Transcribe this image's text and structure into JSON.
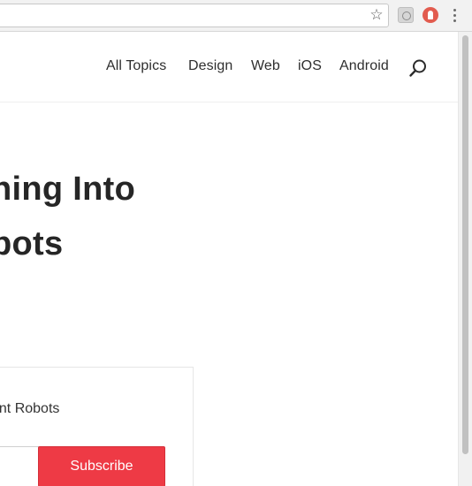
{
  "browser": {
    "star_glyph": "☆",
    "extensions": [
      "extension-icon",
      "extension-icon"
    ],
    "menu_icon": "kebab-menu-icon"
  },
  "nav": {
    "items": [
      "All Topics",
      "Design",
      "Web",
      "iOS",
      "Android"
    ],
    "search_icon": "search-icon"
  },
  "hero": {
    "line1": "ning Into",
    "line2": "bots"
  },
  "newsletter": {
    "text": "ant Robots",
    "email_value": "",
    "subscribe_label": "Subscribe",
    "button_color": "#ee3a45"
  }
}
